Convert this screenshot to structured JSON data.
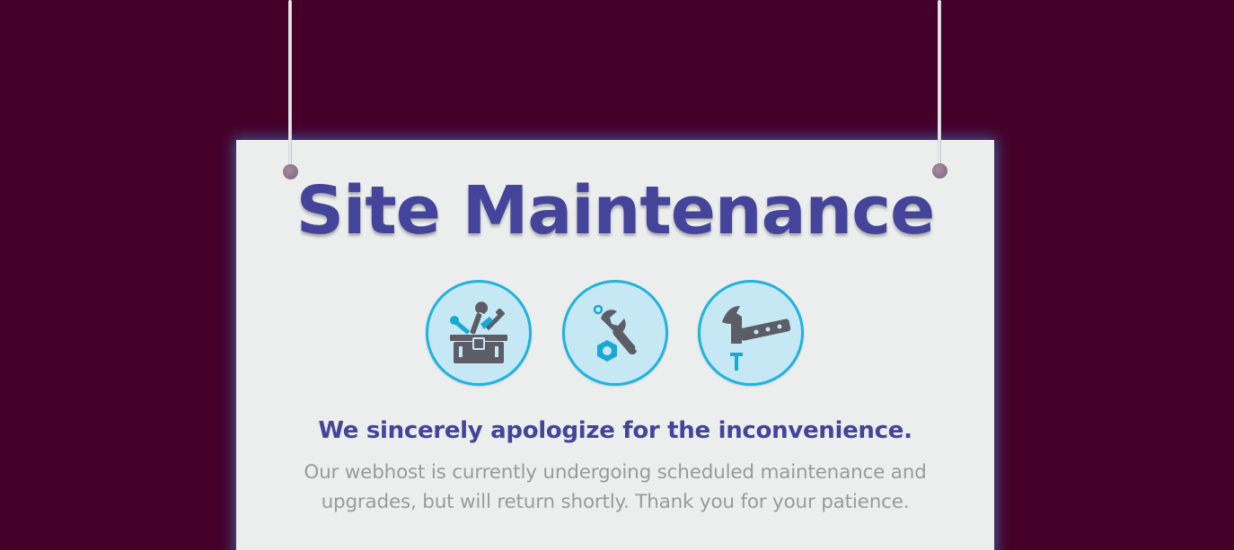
{
  "sign": {
    "title": "Site Maintenance",
    "apology": "We sincerely apologize for the inconvenience.",
    "message": "Our webhost is currently undergoing scheduled maintenance and upgrades, but will return shortly. Thank you for your patience."
  },
  "icons": [
    "toolbox-icon",
    "wrench-nut-icon",
    "hammer-icon"
  ],
  "colors": {
    "background": "#45002a",
    "sign": "#eceeee",
    "title": "#45449b",
    "icon_ring": "#1fb3de",
    "icon_fill": "#c6e8f5",
    "tool_gray": "#5d5d66",
    "tool_accent": "#1aa8d4",
    "message": "#9a9a9a"
  }
}
